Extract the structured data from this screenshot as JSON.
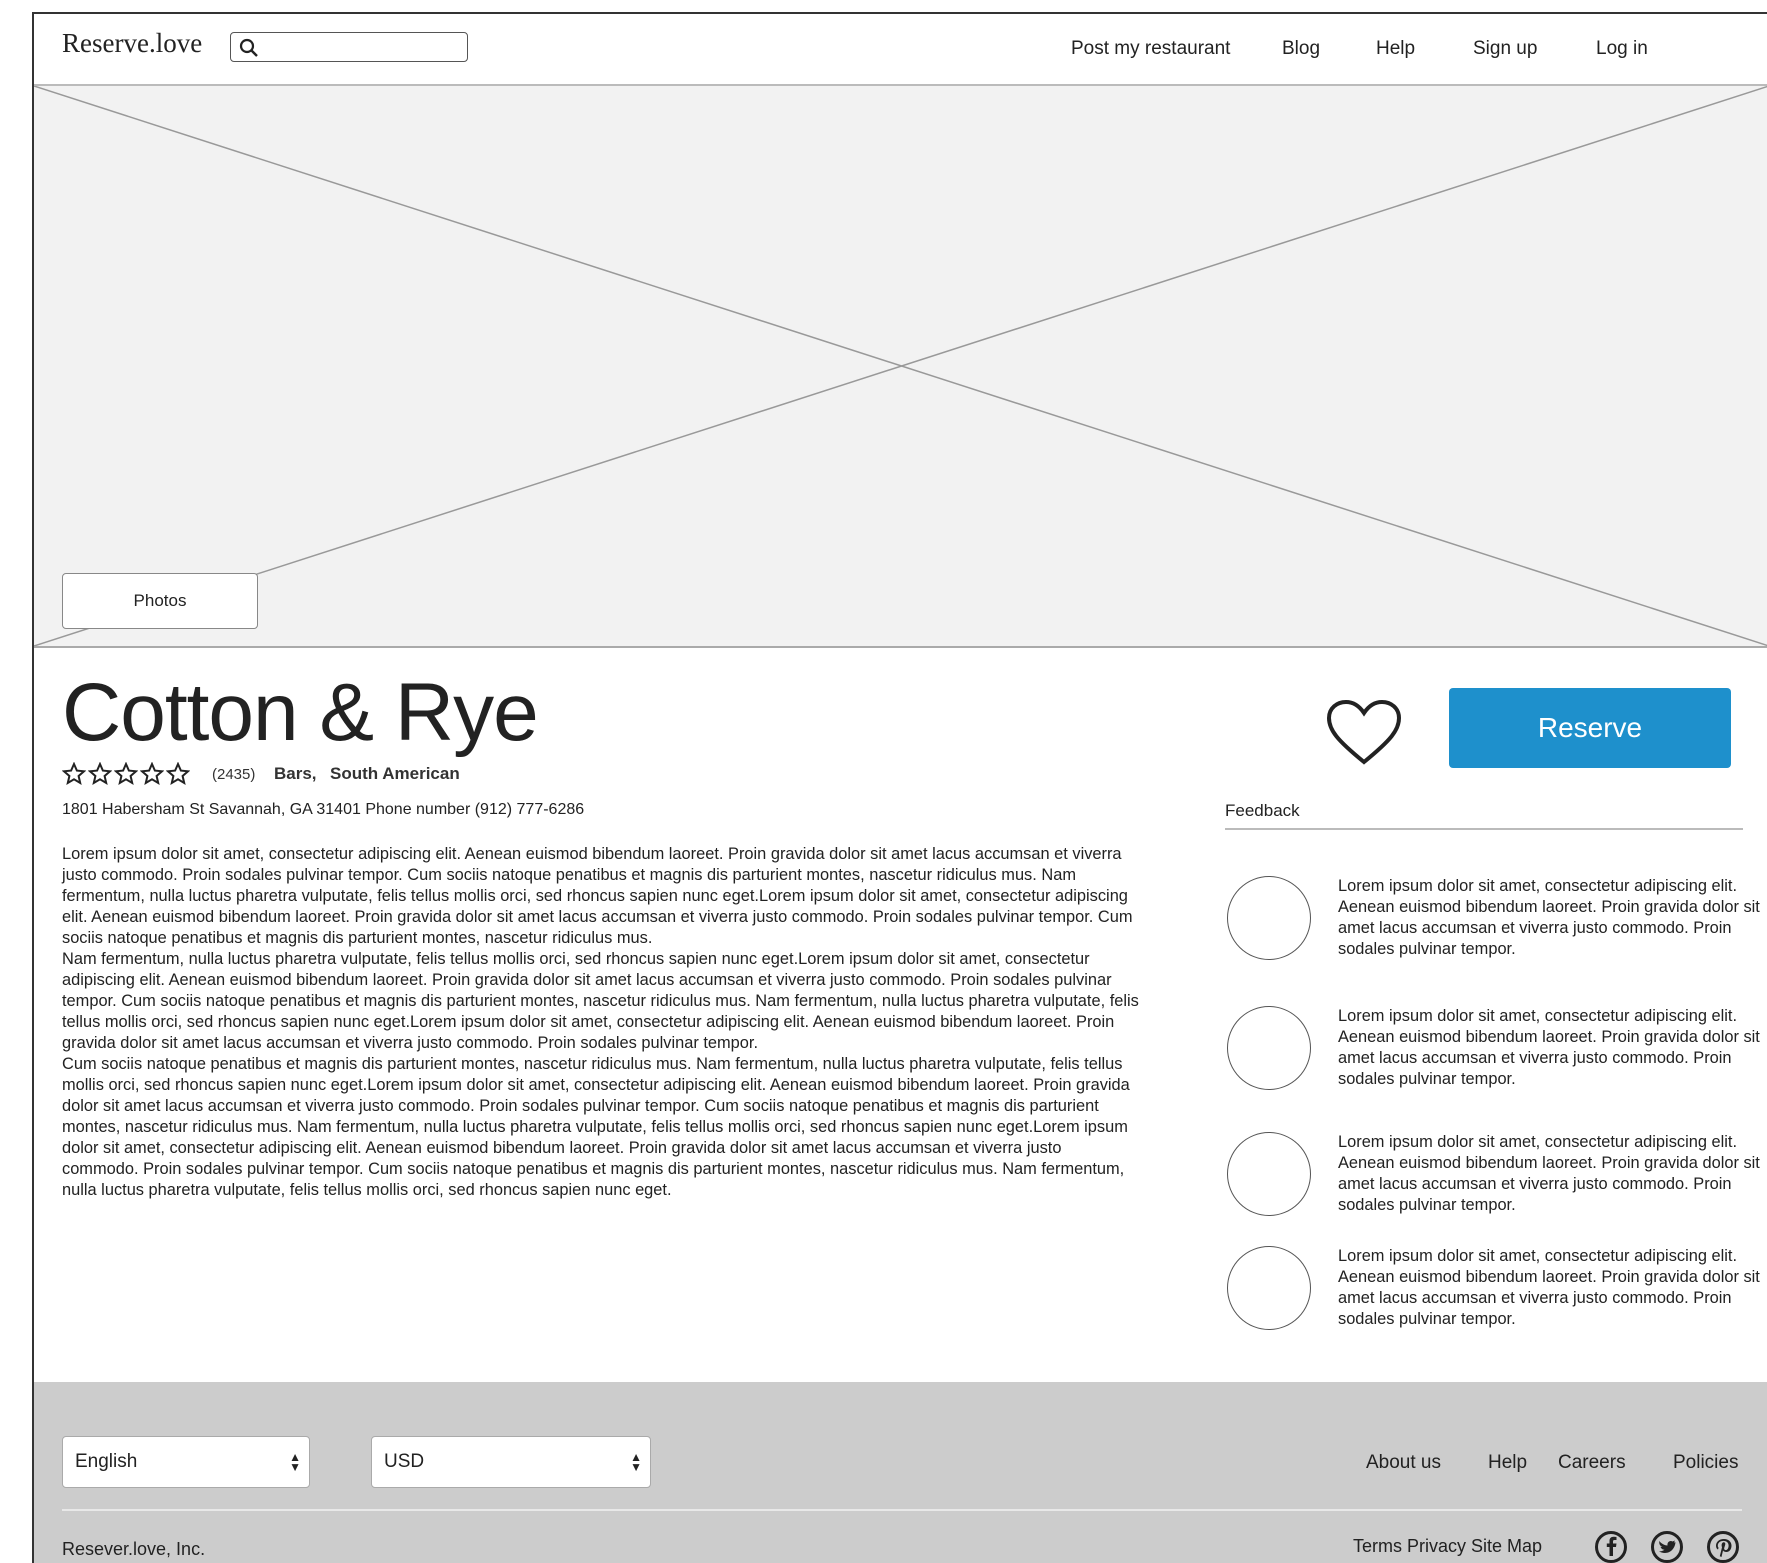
{
  "header": {
    "logo": "Reserve.love",
    "search_placeholder": "",
    "nav": [
      "Post my restaurant",
      "Blog",
      "Help",
      "Sign up",
      "Log in"
    ]
  },
  "hero": {
    "photos_label": "Photos"
  },
  "restaurant": {
    "name": "Cotton & Rye",
    "rating_stars": 0,
    "rating_count": "(2435)",
    "categories": [
      "Bars,",
      "South American"
    ],
    "address": "1801 Habersham St Savannah, GA 31401  Phone number (912) 777-6286",
    "description": [
      "Lorem ipsum dolor sit amet, consectetur adipiscing elit. Aenean euismod bibendum laoreet. Proin gravida dolor sit amet lacus accumsan et viverra justo commodo. Proin sodales pulvinar tempor. Cum sociis natoque penatibus et magnis dis parturient montes, nascetur ridiculus mus. Nam fermentum, nulla luctus pharetra vulputate, felis tellus mollis orci, sed rhoncus sapien nunc eget.Lorem ipsum dolor sit amet, consectetur adipiscing elit. Aenean euismod bibendum laoreet. Proin gravida dolor sit amet lacus accumsan et viverra justo commodo. Proin sodales pulvinar tempor. Cum sociis natoque penatibus et magnis dis parturient montes, nascetur ridiculus mus.",
      " Nam fermentum, nulla luctus pharetra vulputate, felis tellus mollis orci, sed rhoncus sapien nunc eget.Lorem ipsum dolor sit amet, consectetur adipiscing elit. Aenean euismod bibendum laoreet. Proin gravida dolor sit amet lacus accumsan et viverra justo commodo. Proin sodales pulvinar tempor. Cum sociis natoque penatibus et magnis dis parturient montes, nascetur ridiculus mus. Nam fermentum, nulla luctus pharetra vulputate, felis tellus mollis orci, sed rhoncus sapien nunc eget.Lorem ipsum dolor sit amet, consectetur adipiscing elit. Aenean euismod bibendum laoreet. Proin gravida dolor sit amet lacus accumsan et viverra justo commodo. Proin sodales pulvinar tempor.",
      " Cum sociis natoque penatibus et magnis dis parturient montes, nascetur ridiculus mus. Nam fermentum, nulla luctus pharetra vulputate, felis tellus mollis orci, sed rhoncus sapien nunc eget.Lorem ipsum dolor sit amet, consectetur adipiscing elit. Aenean euismod bibendum laoreet. Proin gravida dolor sit amet lacus accumsan et viverra justo commodo. Proin sodales pulvinar tempor. Cum sociis natoque penatibus et magnis dis parturient montes, nascetur ridiculus mus. Nam fermentum, nulla luctus pharetra vulputate, felis tellus mollis orci, sed rhoncus sapien nunc eget.Lorem ipsum dolor sit amet, consectetur adipiscing elit. Aenean euismod bibendum laoreet. Proin gravida dolor sit amet lacus accumsan et viverra justo commodo. Proin sodales pulvinar tempor. Cum sociis natoque penatibus et magnis dis parturient montes, nascetur ridiculus mus. Nam fermentum, nulla luctus pharetra vulputate, felis tellus mollis orci, sed rhoncus sapien nunc eget."
    ],
    "reserve_label": "Reserve",
    "accent_color": "#1e90cc"
  },
  "feedback": {
    "label": "Feedback",
    "reviews": [
      "Lorem ipsum dolor sit amet, consectetur adipiscing elit. Aenean euismod bibendum laoreet. Proin gravida dolor sit amet lacus accumsan et viverra justo commodo. Proin sodales pulvinar tempor.",
      "Lorem ipsum dolor sit amet, consectetur adipiscing elit. Aenean euismod bibendum laoreet. Proin gravida dolor sit amet lacus accumsan et viverra justo commodo. Proin sodales pulvinar tempor.",
      "Lorem ipsum dolor sit amet, consectetur adipiscing elit. Aenean euismod bibendum laoreet. Proin gravida dolor sit amet lacus accumsan et viverra justo commodo. Proin sodales pulvinar tempor.",
      "Lorem ipsum dolor sit amet, consectetur adipiscing elit. Aenean euismod bibendum laoreet. Proin gravida dolor sit amet lacus accumsan et viverra justo commodo. Proin sodales pulvinar tempor."
    ]
  },
  "footer": {
    "language": "English",
    "currency": "USD",
    "links": [
      "About us",
      "Help",
      "Careers",
      "Policies"
    ],
    "copyright": "Resever.love, Inc.",
    "legal": "Terms Privacy Site Map",
    "social_icons": [
      "facebook-icon",
      "twitter-icon",
      "pinterest-icon"
    ]
  }
}
